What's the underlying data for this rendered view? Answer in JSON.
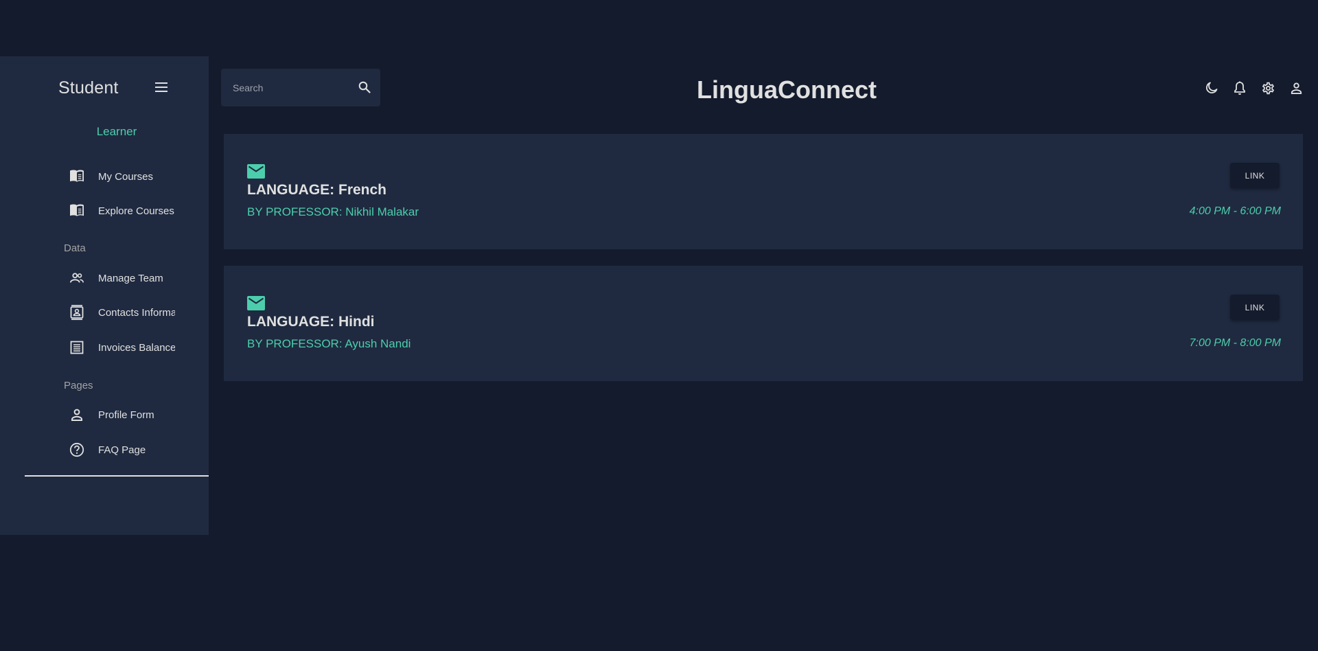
{
  "app": {
    "title": "LinguaConnect"
  },
  "sidebar": {
    "title": "Student",
    "role": "Learner",
    "menu_icon": "hamburger-menu-icon",
    "items": [
      {
        "label": "My Courses",
        "icon": "menu-book-icon"
      },
      {
        "label": "Explore Courses",
        "icon": "menu-book-icon"
      }
    ],
    "sections": [
      {
        "label": "Data",
        "items": [
          {
            "label": "Manage Team",
            "icon": "people-icon"
          },
          {
            "label": "Contacts Information",
            "icon": "contacts-icon"
          },
          {
            "label": "Invoices Balances",
            "icon": "receipt-icon"
          }
        ]
      },
      {
        "label": "Pages",
        "items": [
          {
            "label": "Profile Form",
            "icon": "person-icon"
          },
          {
            "label": "FAQ Page",
            "icon": "help-circle-icon"
          }
        ]
      }
    ]
  },
  "search": {
    "placeholder": "Search",
    "value": ""
  },
  "top_icons": [
    "dark-mode-icon",
    "notifications-icon",
    "settings-icon",
    "person-icon"
  ],
  "courses": [
    {
      "language": "LANGUAGE: French",
      "professor": "BY PROFESSOR: Nikhil Malakar",
      "time": "4:00 PM - 6:00 PM",
      "button_label": "LINK"
    },
    {
      "language": "LANGUAGE: Hindi",
      "professor": "BY PROFESSOR: Ayush Nandi",
      "time": "7:00 PM - 8:00 PM",
      "button_label": "LINK"
    }
  ],
  "colors": {
    "background": "#141b2d",
    "panel": "#1f2a40",
    "accent": "#4cceac",
    "text": "#e0e0e0"
  }
}
